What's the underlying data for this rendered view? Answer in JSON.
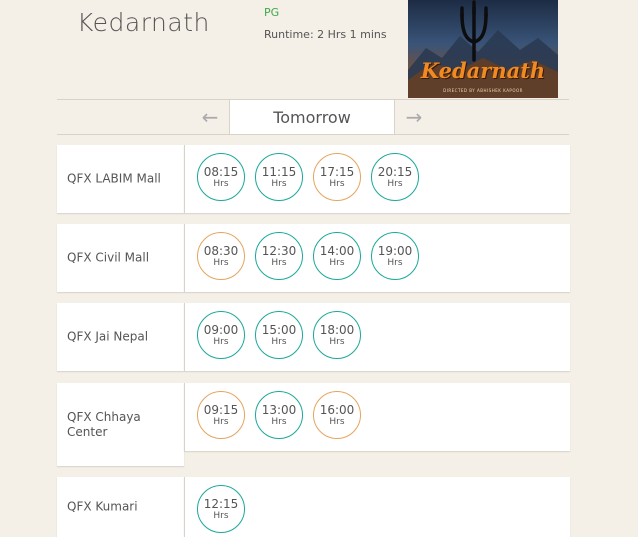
{
  "movie": {
    "title": "Kedarnath",
    "rating": "PG",
    "runtime": "Runtime: 2 Hrs 1 mins",
    "poster_title": "Kedarnath",
    "poster_credit": "DIRECTED BY ABHISHEK KAPOOR"
  },
  "day_selector": {
    "prev_arrow": "←",
    "current": "Tomorrow",
    "next_arrow": "→"
  },
  "colors": {
    "available": "#1aa89b",
    "filling_fast": "#e5a45e",
    "rating_green": "#3ea84a",
    "background": "#f4efe7"
  },
  "cinemas": [
    {
      "name": "QFX LABIM Mall",
      "showtimes": [
        {
          "time": "08:15",
          "unit": "Hrs",
          "status": "available"
        },
        {
          "time": "11:15",
          "unit": "Hrs",
          "status": "available"
        },
        {
          "time": "17:15",
          "unit": "Hrs",
          "status": "filling_fast"
        },
        {
          "time": "20:15",
          "unit": "Hrs",
          "status": "available"
        }
      ]
    },
    {
      "name": "QFX Civil Mall",
      "showtimes": [
        {
          "time": "08:30",
          "unit": "Hrs",
          "status": "filling_fast"
        },
        {
          "time": "12:30",
          "unit": "Hrs",
          "status": "available"
        },
        {
          "time": "14:00",
          "unit": "Hrs",
          "status": "available"
        },
        {
          "time": "19:00",
          "unit": "Hrs",
          "status": "available"
        }
      ]
    },
    {
      "name": "QFX Jai Nepal",
      "showtimes": [
        {
          "time": "09:00",
          "unit": "Hrs",
          "status": "available"
        },
        {
          "time": "15:00",
          "unit": "Hrs",
          "status": "available"
        },
        {
          "time": "18:00",
          "unit": "Hrs",
          "status": "available"
        }
      ]
    },
    {
      "name": "QFX Chhaya Center",
      "showtimes": [
        {
          "time": "09:15",
          "unit": "Hrs",
          "status": "filling_fast"
        },
        {
          "time": "13:00",
          "unit": "Hrs",
          "status": "available"
        },
        {
          "time": "16:00",
          "unit": "Hrs",
          "status": "filling_fast"
        }
      ]
    },
    {
      "name": "QFX Kumari",
      "showtimes": [
        {
          "time": "12:15",
          "unit": "Hrs",
          "status": "available"
        }
      ]
    }
  ]
}
